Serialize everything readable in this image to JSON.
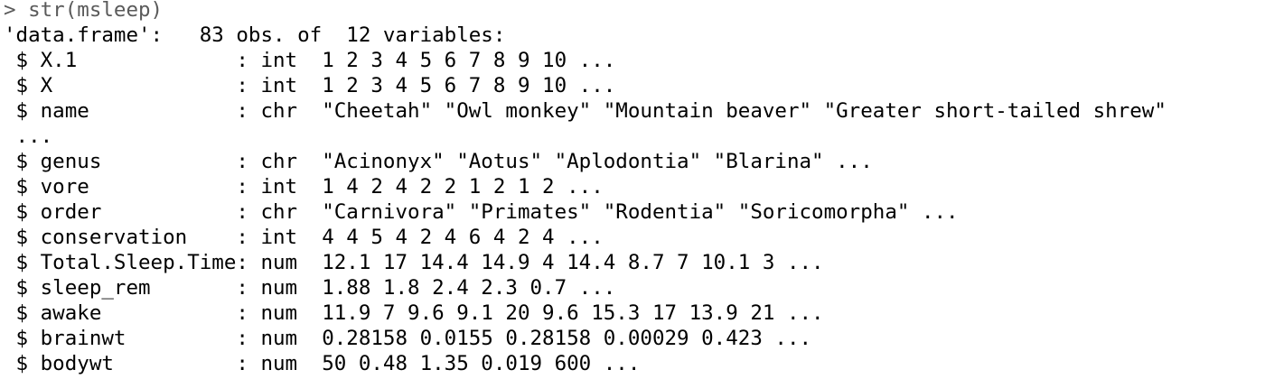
{
  "console": {
    "prompt_symbol": ">",
    "command": "str(msleep)",
    "output_lines": [
      "'data.frame':   83 obs. of  12 variables:",
      " $ X.1             : int  1 2 3 4 5 6 7 8 9 10 ...",
      " $ X               : int  1 2 3 4 5 6 7 8 9 10 ...",
      " $ name            : chr  \"Cheetah\" \"Owl monkey\" \"Mountain beaver\" \"Greater short-tailed shrew\"",
      " ...",
      " $ genus           : chr  \"Acinonyx\" \"Aotus\" \"Aplodontia\" \"Blarina\" ...",
      " $ vore            : int  1 4 2 4 2 2 1 2 1 2 ...",
      " $ order           : chr  \"Carnivora\" \"Primates\" \"Rodentia\" \"Soricomorpha\" ...",
      " $ conservation    : int  4 4 5 4 2 4 6 4 2 4 ...",
      " $ Total.Sleep.Time: num  12.1 17 14.4 14.9 4 14.4 8.7 7 10.1 3 ...",
      " $ sleep_rem       : num  1.88 1.8 2.4 2.3 0.7 ...",
      " $ awake           : num  11.9 7 9.6 9.1 20 9.6 15.3 17 13.9 21 ...",
      " $ brainwt         : num  0.28158 0.0155 0.28158 0.00029 0.423 ...",
      " $ bodywt          : num  50 0.48 1.35 0.019 600 ..."
    ]
  }
}
